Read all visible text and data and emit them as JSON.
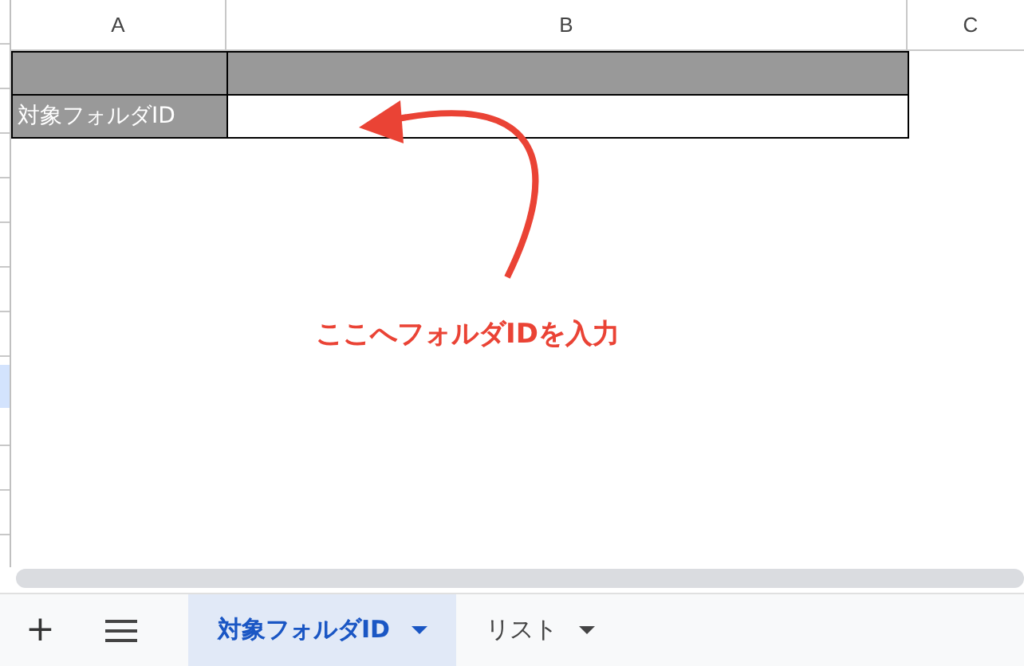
{
  "column_headers": [
    "A",
    "B",
    "C"
  ],
  "cells": [
    {
      "kind": "header_fill"
    },
    {
      "kind": "label_row",
      "a": "対象フォルダID"
    }
  ],
  "annotation": {
    "text": "ここへフォルダIDを入力",
    "color": "#ea4335"
  },
  "sheet_tabs": [
    {
      "label": "対象フォルダID",
      "selected": true
    },
    {
      "label": "リスト",
      "selected": false
    }
  ],
  "toolbar": {
    "add": "+"
  }
}
